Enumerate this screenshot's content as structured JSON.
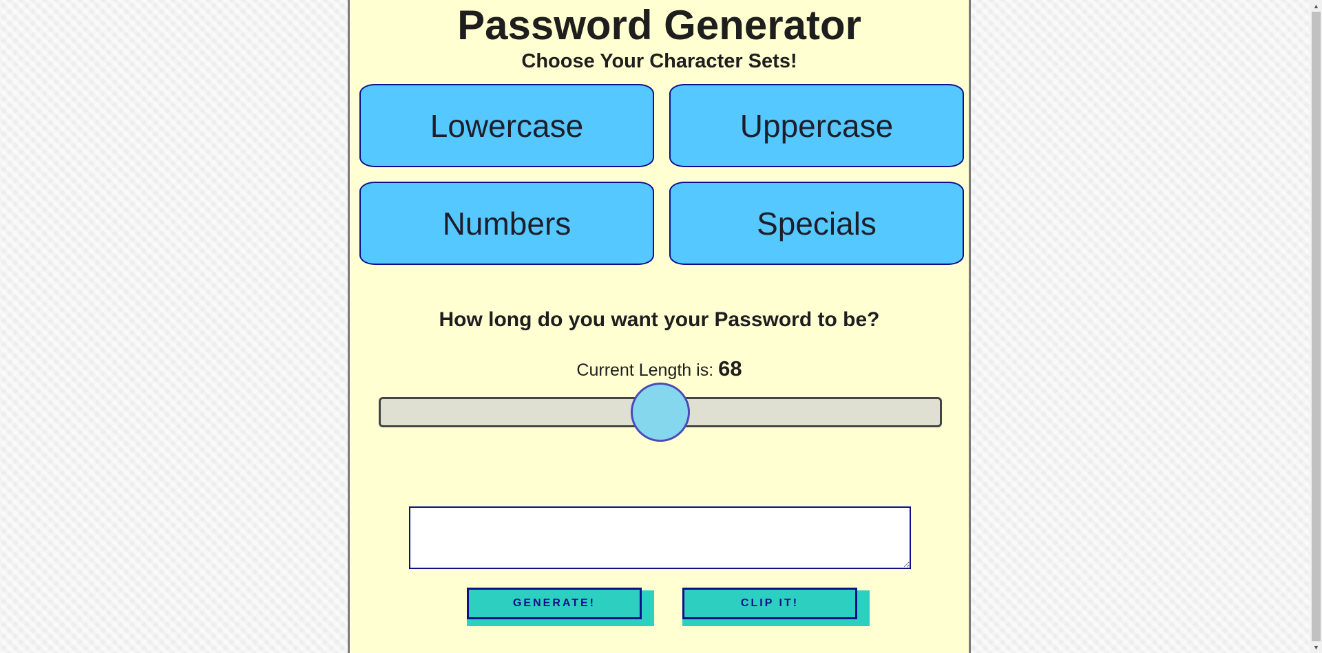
{
  "header": {
    "title": "Password Generator",
    "subtitle": "Choose Your Character Sets!"
  },
  "charsets": {
    "lowercase": "Lowercase",
    "uppercase": "Uppercase",
    "numbers": "Numbers",
    "specials": "Specials"
  },
  "length": {
    "question": "How long do you want your Password to be?",
    "label": "Current Length is: ",
    "value": "68",
    "slider_fraction": 0.5
  },
  "password": {
    "value": "",
    "placeholder": ""
  },
  "actions": {
    "generate_label": "GENERATE!",
    "clip_label": "CLIP IT!"
  },
  "colors": {
    "panel_bg": "#ffffd2",
    "charset_button": "#55c8ff",
    "action_button": "#2dcfc1",
    "border_accent": "#0e0e8a",
    "slider_thumb": "#85d7ee"
  }
}
